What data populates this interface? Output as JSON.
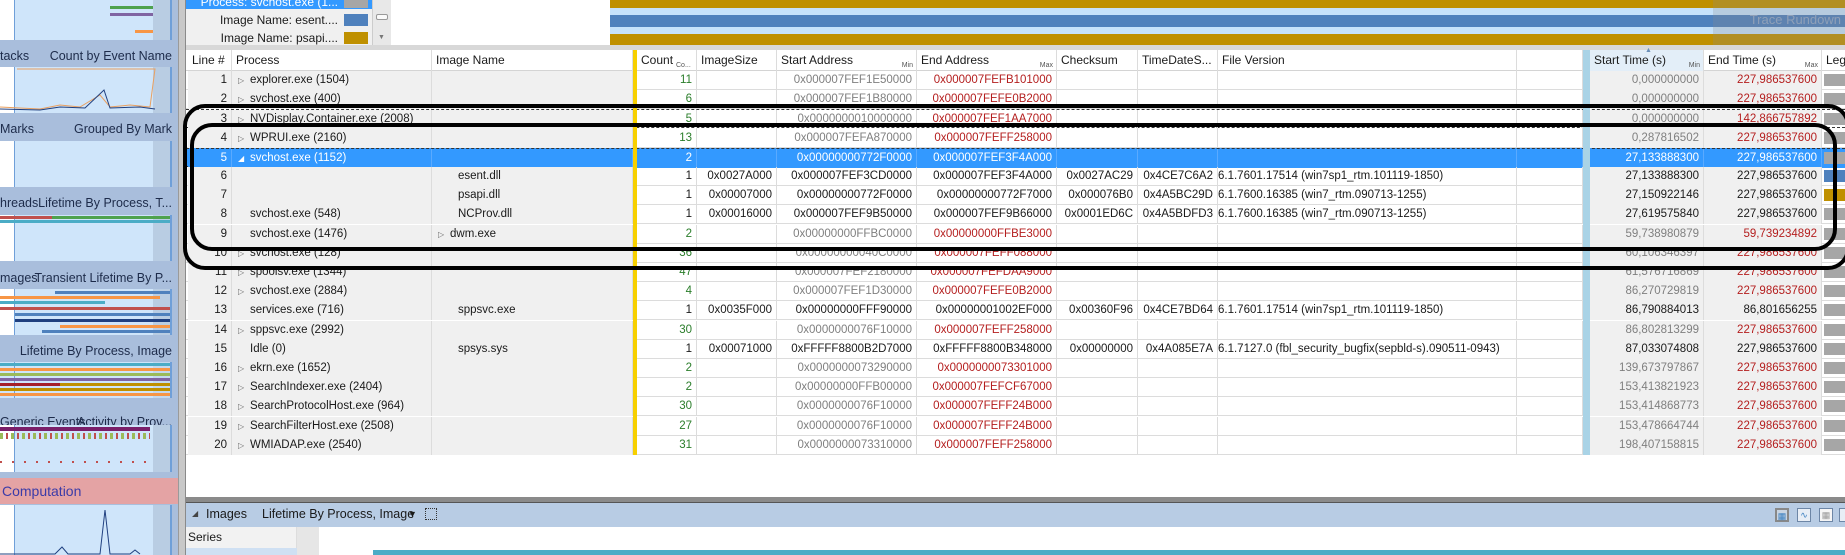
{
  "left_panel": {
    "sections": [
      {
        "left": "tacks",
        "right": "Count by Event Name"
      },
      {
        "left": "Marks",
        "right": "Grouped By Mark"
      },
      {
        "left": "hreads",
        "right": "Lifetime By Process, T..."
      },
      {
        "left": "mages",
        "right": "Transient Lifetime By P..."
      },
      {
        "left": "",
        "right": "Lifetime By Process, Image"
      },
      {
        "left": "Generic Events",
        "right": "Activity by Prov..."
      }
    ],
    "computation_label": "Computation"
  },
  "top_legend": {
    "items": [
      {
        "label": "Process: svchost.exe (1...",
        "color": "#a6a6a6"
      },
      {
        "label": "Image Name: esent....",
        "color": "#4f81bd"
      },
      {
        "label": "Image Name: psapi....",
        "color": "#bf9000"
      }
    ],
    "watermark": "Trace Rundown"
  },
  "table": {
    "columns": {
      "line": "Line #",
      "process": "Process",
      "image": "Image Name",
      "count": "Count",
      "count_sub": "Co...",
      "imagesize": "ImageSize",
      "start": "Start Address",
      "start_sub": "Min",
      "end": "End Address",
      "end_sub": "Max",
      "checksum": "Checksum",
      "tds": "TimeDateS...",
      "fv": "File Version",
      "starttime": "Start Time (s)",
      "starttime_sub": "Min",
      "endtime": "End Time (s)",
      "endtime_sub": "Max",
      "legend": "Leg"
    },
    "rows": [
      {
        "line": "1",
        "exp": "c",
        "process": "explorer.exe (1504)",
        "image": "",
        "count": "11",
        "imagesize": "",
        "start": "0x000007FEF1E50000",
        "end": "0x000007FEFB101000",
        "checksum": "",
        "tds": "",
        "fv": "",
        "st": "0,000000000",
        "et": "227,986537600",
        "kind": "sum",
        "leg": "#a6a6a6"
      },
      {
        "line": "2",
        "exp": "c",
        "process": "svchost.exe (400)",
        "image": "",
        "count": "6",
        "imagesize": "",
        "start": "0x000007FEF1B80000",
        "end": "0x000007FEFE0B2000",
        "checksum": "",
        "tds": "",
        "fv": "",
        "st": "0,000000000",
        "et": "227,986537600",
        "kind": "sum",
        "leg": "#a6a6a6"
      },
      {
        "line": "3",
        "exp": "c",
        "process": "NVDisplay.Container.exe (2008)",
        "image": "",
        "count": "5",
        "imagesize": "",
        "start": "0x0000000010000000",
        "end": "0x000007FEF1AA7000",
        "checksum": "",
        "tds": "",
        "fv": "",
        "st": "0,000000000",
        "et": "142,866757892",
        "kind": "sum",
        "leg": "#a6a6a6"
      },
      {
        "line": "4",
        "exp": "c",
        "process": "WPRUI.exe (2160)",
        "image": "",
        "count": "13",
        "imagesize": "",
        "start": "0x000007FEFA870000",
        "end": "0x000007FEFF258000",
        "checksum": "",
        "tds": "",
        "fv": "",
        "st": "0,287816502",
        "et": "227,986537600",
        "kind": "sum",
        "leg": "#a6a6a6"
      },
      {
        "line": "5",
        "exp": "o",
        "process": "svchost.exe (1152)",
        "image": "",
        "count": "2",
        "imagesize": "",
        "start": "0x00000000772F0000",
        "end": "0x000007FEF3F4A000",
        "checksum": "",
        "tds": "",
        "fv": "",
        "st": "27,133888300",
        "et": "227,986537600",
        "kind": "sel",
        "leg": "#a6a6a6"
      },
      {
        "line": "6",
        "exp": "",
        "process": "",
        "image": "esent.dll",
        "count": "1",
        "imagesize": "0x0027A000",
        "start": "0x000007FEF3CD0000",
        "end": "0x000007FEF3F4A000",
        "checksum": "0x0027AC29",
        "tds": "0x4CE7C6A2",
        "fv": "6.1.7601.17514 (win7sp1_rtm.101119-1850)",
        "st": "27,133888300",
        "et": "227,986537600",
        "kind": "leaf",
        "leg": "#4f81bd"
      },
      {
        "line": "7",
        "exp": "",
        "process": "",
        "image": "psapi.dll",
        "count": "1",
        "imagesize": "0x00007000",
        "start": "0x00000000772F0000",
        "end": "0x00000000772F7000",
        "checksum": "0x000076B0",
        "tds": "0x4A5BC29D",
        "fv": "6.1.7600.16385 (win7_rtm.090713-1255)",
        "st": "27,150922146",
        "et": "227,986537600",
        "kind": "leaf",
        "leg": "#bf9000"
      },
      {
        "line": "8",
        "exp": "",
        "process": "svchost.exe (548)",
        "image": "NCProv.dll",
        "count": "1",
        "imagesize": "0x00016000",
        "start": "0x000007FEF9B50000",
        "end": "0x000007FEF9B66000",
        "checksum": "0x0001ED6C",
        "tds": "0x4A5BDFD3",
        "fv": "6.1.7600.16385 (win7_rtm.090713-1255)",
        "st": "27,619575840",
        "et": "227,986537600",
        "kind": "leaf",
        "leg": "#a6a6a6"
      },
      {
        "line": "9",
        "exp": "",
        "process": "svchost.exe (1476)",
        "image": "dwm.exe",
        "imgexp": "c",
        "count": "2",
        "imagesize": "",
        "start": "0x00000000FFBC0000",
        "end": "0x00000000FFBE3000",
        "checksum": "",
        "tds": "",
        "fv": "",
        "st": "59,738980879",
        "et": "59,739234892",
        "kind": "sum",
        "leg": "#a6a6a6"
      },
      {
        "line": "10",
        "exp": "c",
        "process": "svchost.exe (128)",
        "image": "",
        "count": "36",
        "imagesize": "",
        "start": "0x00000000040C0000",
        "end": "0x000007FEFF088000",
        "checksum": "",
        "tds": "",
        "fv": "",
        "st": "60,106346397",
        "et": "227,986537600",
        "kind": "sum",
        "leg": "#a6a6a6"
      },
      {
        "line": "11",
        "exp": "c",
        "process": "spoolsv.exe (1344)",
        "image": "",
        "count": "47",
        "imagesize": "",
        "start": "0x000007FEF2180000",
        "end": "0x000007FEFDAA9000",
        "checksum": "",
        "tds": "",
        "fv": "",
        "st": "61,576716869",
        "et": "227,986537600",
        "kind": "sum",
        "leg": "#a6a6a6"
      },
      {
        "line": "12",
        "exp": "c",
        "process": "svchost.exe (2884)",
        "image": "",
        "count": "4",
        "imagesize": "",
        "start": "0x000007FEF1D30000",
        "end": "0x000007FEFE0B2000",
        "checksum": "",
        "tds": "",
        "fv": "",
        "st": "86,270729819",
        "et": "227,986537600",
        "kind": "sum",
        "leg": "#a6a6a6"
      },
      {
        "line": "13",
        "exp": "",
        "process": "services.exe (716)",
        "image": "sppsvc.exe",
        "count": "1",
        "imagesize": "0x0035F000",
        "start": "0x00000000FFF90000",
        "end": "0x00000001002EF000",
        "checksum": "0x00360F96",
        "tds": "0x4CE7BD64",
        "fv": "6.1.7601.17514 (win7sp1_rtm.101119-1850)",
        "st": "86,790884013",
        "et": "86,801656255",
        "kind": "leaf",
        "leg": "#a6a6a6"
      },
      {
        "line": "14",
        "exp": "c",
        "process": "sppsvc.exe (2992)",
        "image": "",
        "count": "30",
        "imagesize": "",
        "start": "0x0000000076F10000",
        "end": "0x000007FEFF258000",
        "checksum": "",
        "tds": "",
        "fv": "",
        "st": "86,802813299",
        "et": "227,986537600",
        "kind": "sum",
        "leg": "#a6a6a6"
      },
      {
        "line": "15",
        "exp": "",
        "process": "Idle (0)",
        "image": "spsys.sys",
        "count": "1",
        "imagesize": "0x00071000",
        "start": "0xFFFFF8800B2D7000",
        "end": "0xFFFFF8800B348000",
        "checksum": "0x00000000",
        "tds": "0x4A085E7A",
        "fv": "6.1.7127.0 (fbl_security_bugfix(sepbld-s).090511-0943)",
        "st": "87,033074808",
        "et": "227,986537600",
        "kind": "leaf",
        "leg": "#a6a6a6"
      },
      {
        "line": "16",
        "exp": "c",
        "process": "ekrn.exe (1652)",
        "image": "",
        "count": "2",
        "imagesize": "",
        "start": "0x0000000073290000",
        "end": "0x0000000073301000",
        "checksum": "",
        "tds": "",
        "fv": "",
        "st": "139,673797867",
        "et": "227,986537600",
        "kind": "sum",
        "leg": "#a6a6a6"
      },
      {
        "line": "17",
        "exp": "c",
        "process": "SearchIndexer.exe (2404)",
        "image": "",
        "count": "2",
        "imagesize": "",
        "start": "0x00000000FFB00000",
        "end": "0x000007FEFCF67000",
        "checksum": "",
        "tds": "",
        "fv": "",
        "st": "153,413821923",
        "et": "227,986537600",
        "kind": "sum",
        "leg": "#a6a6a6"
      },
      {
        "line": "18",
        "exp": "c",
        "process": "SearchProtocolHost.exe (964)",
        "image": "",
        "count": "30",
        "imagesize": "",
        "start": "0x0000000076F10000",
        "end": "0x000007FEFF24B000",
        "checksum": "",
        "tds": "",
        "fv": "",
        "st": "153,414868773",
        "et": "227,986537600",
        "kind": "sum",
        "leg": "#a6a6a6"
      },
      {
        "line": "19",
        "exp": "c",
        "process": "SearchFilterHost.exe (2508)",
        "image": "",
        "count": "27",
        "imagesize": "",
        "start": "0x0000000076F10000",
        "end": "0x000007FEFF24B000",
        "checksum": "",
        "tds": "",
        "fv": "",
        "st": "153,478664744",
        "et": "227,986537600",
        "kind": "sum",
        "leg": "#a6a6a6"
      },
      {
        "line": "20",
        "exp": "c",
        "process": "WMIADAP.exe (2540)",
        "image": "",
        "count": "31",
        "imagesize": "",
        "start": "0x0000000073310000",
        "end": "0x000007FEFF258000",
        "checksum": "",
        "tds": "",
        "fv": "",
        "st": "198,407158815",
        "et": "227,986537600",
        "kind": "sum",
        "leg": "#a6a6a6"
      }
    ]
  },
  "bottom_panel": {
    "collapse_label": "Images",
    "view_label": "Lifetime By Process, Image",
    "series_header": "Series"
  },
  "colors": {
    "selection": "#3399ff",
    "accent_yellow": "#f7d000",
    "gold": "#bf9000",
    "blue": "#4f81bd"
  }
}
